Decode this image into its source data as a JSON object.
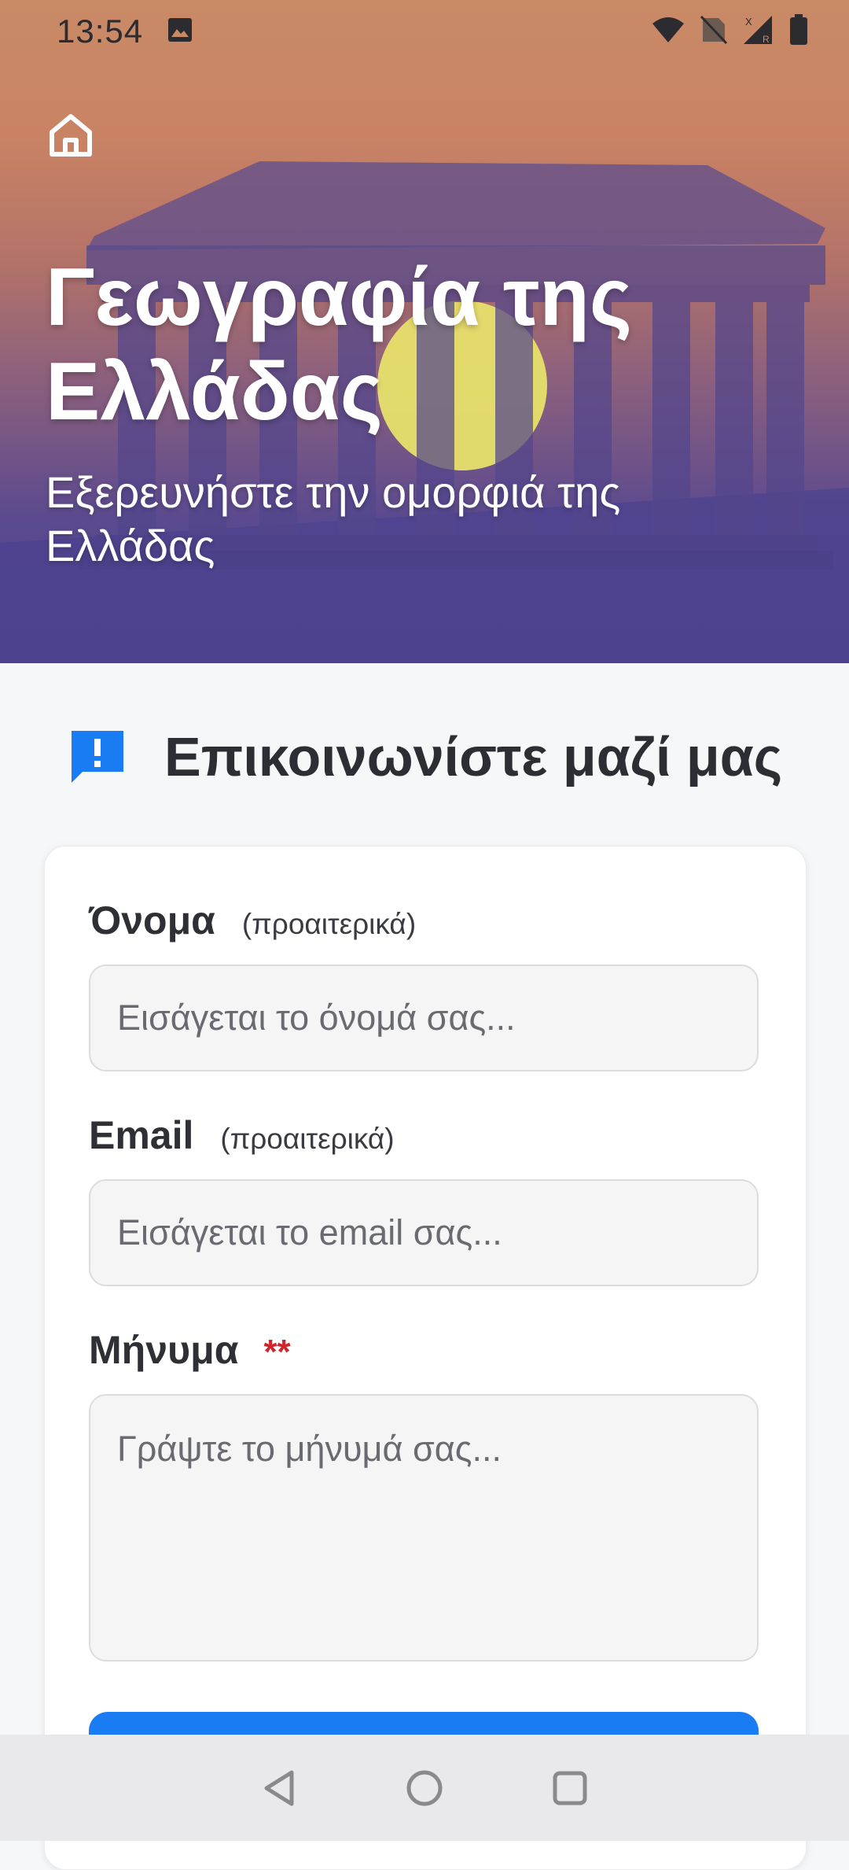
{
  "status": {
    "time": "13:54",
    "icons": [
      "image-icon",
      "wifi-icon",
      "no-sim-icon",
      "signal-icon",
      "battery-icon"
    ]
  },
  "hero": {
    "title": "Γεωγραφία της Ελλάδας",
    "subtitle": "Εξερευνήστε την ομορφιά της Ελλάδας",
    "home_icon": "home-icon"
  },
  "contact": {
    "heading": "Επικοινωνίστε μαζί μας",
    "heading_icon": "feedback-icon",
    "name": {
      "label": "Όνομα",
      "hint": "(προαιτερικά)",
      "placeholder": "Εισάγεται το όνομά σας..."
    },
    "email": {
      "label": "Email",
      "hint": "(προαιτερικά)",
      "placeholder": "Εισάγεται το email σας..."
    },
    "message": {
      "label": "Μήνυμα",
      "required_mark": "**",
      "placeholder": "Γράψτε το μήνυμά σας..."
    }
  },
  "colors": {
    "accent": "#1a7cf2",
    "required": "#d0252b",
    "hero_top": "#c98a66",
    "hero_bottom": "#4f4489"
  },
  "nav": {
    "icons": [
      "back-icon",
      "home-nav-icon",
      "recents-icon"
    ]
  }
}
